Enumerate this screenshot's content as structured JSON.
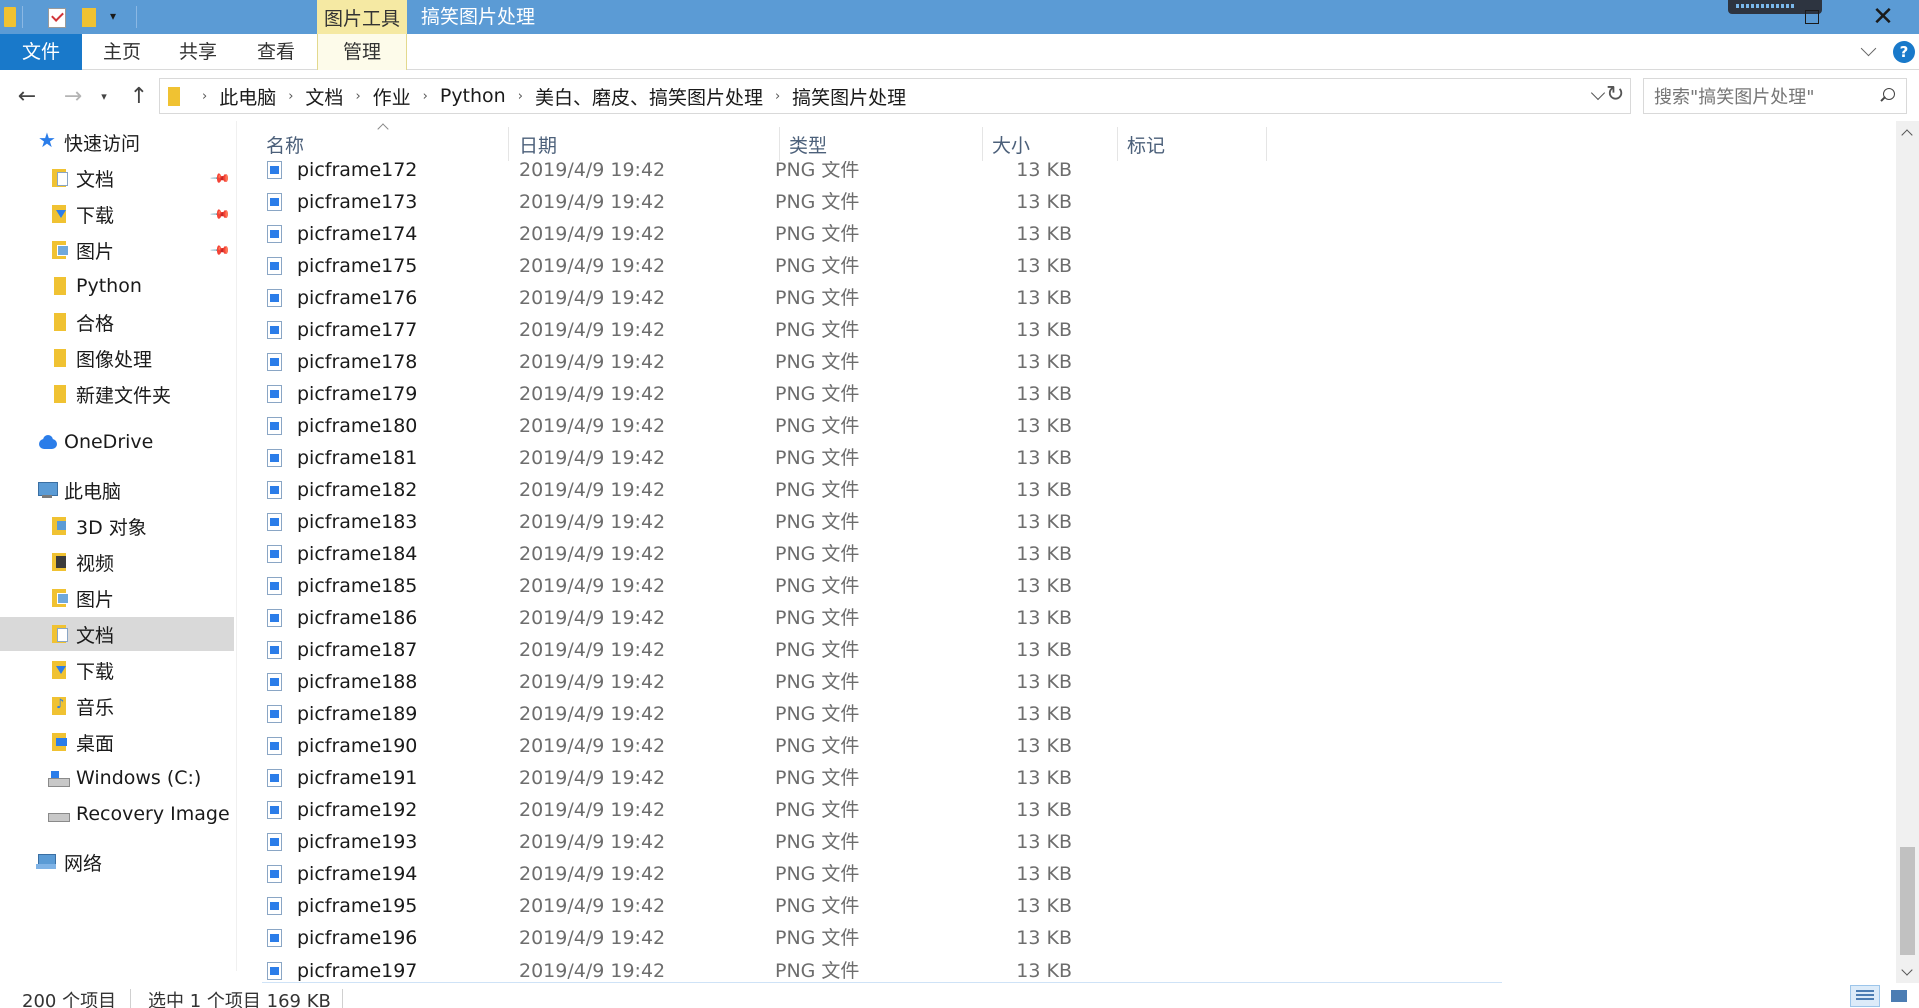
{
  "title_bar": {
    "context_tab_header": "图片工具",
    "window_title": "搞笑图片处理"
  },
  "ribbon": {
    "tabs": [
      "文件",
      "主页",
      "共享",
      "查看",
      "管理"
    ]
  },
  "address_bar": {
    "breadcrumbs": [
      "此电脑",
      "文档",
      "作业",
      "Python",
      "美白、磨皮、搞笑图片处理",
      "搞笑图片处理"
    ],
    "search_placeholder": "搜索\"搞笑图片处理\""
  },
  "nav_pane": {
    "quick_access": "快速访问",
    "quick_items": [
      "文档",
      "下载",
      "图片",
      "Python",
      "合格",
      "图像处理",
      "新建文件夹"
    ],
    "onedrive": "OneDrive",
    "this_pc": "此电脑",
    "pc_items": [
      "3D 对象",
      "视频",
      "图片",
      "文档",
      "下载",
      "音乐",
      "桌面",
      "Windows (C:)",
      "Recovery Image (D"
    ],
    "network": "网络"
  },
  "columns": [
    "名称",
    "日期",
    "类型",
    "大小",
    "标记"
  ],
  "files": [
    {
      "name": "picframe172",
      "date": "2019/4/9 19:42",
      "type": "PNG 文件",
      "size": "13 KB"
    },
    {
      "name": "picframe173",
      "date": "2019/4/9 19:42",
      "type": "PNG 文件",
      "size": "13 KB"
    },
    {
      "name": "picframe174",
      "date": "2019/4/9 19:42",
      "type": "PNG 文件",
      "size": "13 KB"
    },
    {
      "name": "picframe175",
      "date": "2019/4/9 19:42",
      "type": "PNG 文件",
      "size": "13 KB"
    },
    {
      "name": "picframe176",
      "date": "2019/4/9 19:42",
      "type": "PNG 文件",
      "size": "13 KB"
    },
    {
      "name": "picframe177",
      "date": "2019/4/9 19:42",
      "type": "PNG 文件",
      "size": "13 KB"
    },
    {
      "name": "picframe178",
      "date": "2019/4/9 19:42",
      "type": "PNG 文件",
      "size": "13 KB"
    },
    {
      "name": "picframe179",
      "date": "2019/4/9 19:42",
      "type": "PNG 文件",
      "size": "13 KB"
    },
    {
      "name": "picframe180",
      "date": "2019/4/9 19:42",
      "type": "PNG 文件",
      "size": "13 KB"
    },
    {
      "name": "picframe181",
      "date": "2019/4/9 19:42",
      "type": "PNG 文件",
      "size": "13 KB"
    },
    {
      "name": "picframe182",
      "date": "2019/4/9 19:42",
      "type": "PNG 文件",
      "size": "13 KB"
    },
    {
      "name": "picframe183",
      "date": "2019/4/9 19:42",
      "type": "PNG 文件",
      "size": "13 KB"
    },
    {
      "name": "picframe184",
      "date": "2019/4/9 19:42",
      "type": "PNG 文件",
      "size": "13 KB"
    },
    {
      "name": "picframe185",
      "date": "2019/4/9 19:42",
      "type": "PNG 文件",
      "size": "13 KB"
    },
    {
      "name": "picframe186",
      "date": "2019/4/9 19:42",
      "type": "PNG 文件",
      "size": "13 KB"
    },
    {
      "name": "picframe187",
      "date": "2019/4/9 19:42",
      "type": "PNG 文件",
      "size": "13 KB"
    },
    {
      "name": "picframe188",
      "date": "2019/4/9 19:42",
      "type": "PNG 文件",
      "size": "13 KB"
    },
    {
      "name": "picframe189",
      "date": "2019/4/9 19:42",
      "type": "PNG 文件",
      "size": "13 KB"
    },
    {
      "name": "picframe190",
      "date": "2019/4/9 19:42",
      "type": "PNG 文件",
      "size": "13 KB"
    },
    {
      "name": "picframe191",
      "date": "2019/4/9 19:42",
      "type": "PNG 文件",
      "size": "13 KB"
    },
    {
      "name": "picframe192",
      "date": "2019/4/9 19:42",
      "type": "PNG 文件",
      "size": "13 KB"
    },
    {
      "name": "picframe193",
      "date": "2019/4/9 19:42",
      "type": "PNG 文件",
      "size": "13 KB"
    },
    {
      "name": "picframe194",
      "date": "2019/4/9 19:42",
      "type": "PNG 文件",
      "size": "13 KB"
    },
    {
      "name": "picframe195",
      "date": "2019/4/9 19:42",
      "type": "PNG 文件",
      "size": "13 KB"
    },
    {
      "name": "picframe196",
      "date": "2019/4/9 19:42",
      "type": "PNG 文件",
      "size": "13 KB"
    },
    {
      "name": "picframe197",
      "date": "2019/4/9 19:42",
      "type": "PNG 文件",
      "size": "13 KB"
    }
  ],
  "status_bar": {
    "item_count": "200 个项目",
    "selection": "选中 1 个项目  169 KB"
  },
  "colors": {
    "title_bar": "#5b9bd5",
    "file_tab": "#1979ca",
    "context_tab": "#f5e9a3",
    "selected_nav": "#d9d9d9"
  }
}
